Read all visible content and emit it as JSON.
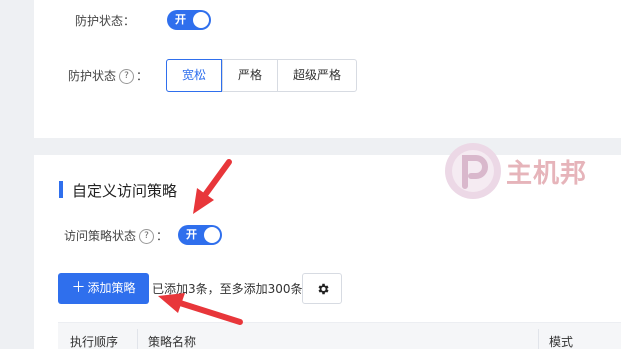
{
  "protection": {
    "status_label": "防护状态：",
    "status_toggle": "开",
    "mode_label": "防护状态",
    "help_glyph": "?",
    "colon": "：",
    "modes": [
      "宽松",
      "严格",
      "超级严格"
    ],
    "active_mode": "宽松"
  },
  "custom_access": {
    "section_title": "自定义访问策略",
    "status_label": "访问策略状态",
    "help_glyph": "?",
    "colon": "：",
    "status_toggle": "开",
    "add_button_icon": "＋",
    "add_button": "添加策略",
    "hint": "已添加3条，至多添加300条",
    "settings_icon": "gear-icon"
  },
  "table": {
    "columns": [
      "执行顺序",
      "策略名称",
      "模式"
    ]
  },
  "watermark": {
    "text": "主机邦"
  },
  "colors": {
    "accent": "#2f6fed",
    "arrow": "#e8363a",
    "watermark": "#e6b4ba"
  }
}
